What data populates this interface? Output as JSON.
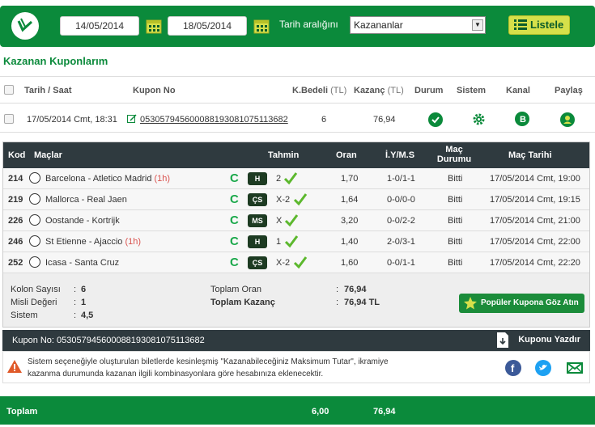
{
  "filters": {
    "start_date": "14/05/2014",
    "end_date": "18/05/2014",
    "range_label": "Tarih aralığını",
    "type_selected": "Kazananlar",
    "list_button": "Listele"
  },
  "section_title": "Kazanan Kuponlarım",
  "coupons_table": {
    "headers": {
      "date": "Tarih / Saat",
      "coupon_no": "Kupon No",
      "stake": "K.Bedeli",
      "stake_unit": "(TL)",
      "win": "Kazanç",
      "win_unit": "(TL)",
      "status": "Durum",
      "system": "Sistem",
      "channel": "Kanal",
      "share": "Paylaş"
    },
    "row": {
      "date": "17/05/2014 Cmt, 18:31",
      "coupon_no": "0530579456000881930810751136​82",
      "stake": "6",
      "win": "76,94"
    }
  },
  "matches_table": {
    "headers": {
      "code": "Kod",
      "matches": "Maçlar",
      "pick": "Tahmin",
      "odds": "Oran",
      "ht_ft": "İ.Y/M.S",
      "status_l1": "Maç",
      "status_l2": "Durumu",
      "date": "Maç Tarihi"
    },
    "rows": [
      {
        "code": "214",
        "match": "Barcelona - Atletico Madrid",
        "minute": "(1h)",
        "badge": "C",
        "pick_type": "H",
        "pick": "2",
        "odds": "1,70",
        "ht_ft": "1-0/1-1",
        "status": "Bitti",
        "date": "17/05/2014 Cmt, 19:00"
      },
      {
        "code": "219",
        "match": "Mallorca - Real Jaen",
        "minute": "",
        "badge": "C",
        "pick_type": "ÇS",
        "pick": "X-2",
        "odds": "1,64",
        "ht_ft": "0-0/0-0",
        "status": "Bitti",
        "date": "17/05/2014 Cmt, 19:15"
      },
      {
        "code": "226",
        "match": "Oostande - Kortrijk",
        "minute": "",
        "badge": "C",
        "pick_type": "MS",
        "pick": "X",
        "odds": "3,20",
        "ht_ft": "0-0/2-2",
        "status": "Bitti",
        "date": "17/05/2014 Cmt, 21:00"
      },
      {
        "code": "246",
        "match": "St Etienne - Ajaccio",
        "minute": "(1h)",
        "badge": "C",
        "pick_type": "H",
        "pick": "1",
        "odds": "1,40",
        "ht_ft": "2-0/3-1",
        "status": "Bitti",
        "date": "17/05/2014 Cmt, 22:00"
      },
      {
        "code": "252",
        "match": "Icasa - Santa Cruz",
        "minute": "",
        "badge": "C",
        "pick_type": "ÇS",
        "pick": "X-2",
        "odds": "1,60",
        "ht_ft": "0-0/1-1",
        "status": "Bitti",
        "date": "17/05/2014 Cmt, 22:20"
      }
    ]
  },
  "summary": {
    "kolon_label": "Kolon Sayısı",
    "kolon_value": "6",
    "misli_label": "Misli Değeri",
    "misli_value": "1",
    "sistem_label": "Sistem",
    "sistem_value": "4,5",
    "total_odds_label": "Toplam Oran",
    "total_odds_value": "76,94",
    "total_win_label": "Toplam Kazanç",
    "total_win_value": "76,94 TL",
    "colon": ":",
    "popular_button": "Popüler Kupona Göz Atın"
  },
  "coupon_bar": {
    "label": "Kupon No: 0530579456000881930810751136​82",
    "print": "Kuponu Yazdır"
  },
  "warning": {
    "text": "Sistem seçeneğiyle oluşturulan biletlerde kesinleşmiş \"Kazanabileceğiniz Maksimum Tutar\", ikramiye kazanma durumunda kazanan ilgili kombinasyonlara göre hesabınıza eklenecektir."
  },
  "footer": {
    "label": "Toplam",
    "stake": "6,00",
    "win": "76,94"
  },
  "colors": {
    "brand_green": "#0b8a3b",
    "dark_header": "#2f3a3f",
    "button_lime": "#d6e04a"
  }
}
